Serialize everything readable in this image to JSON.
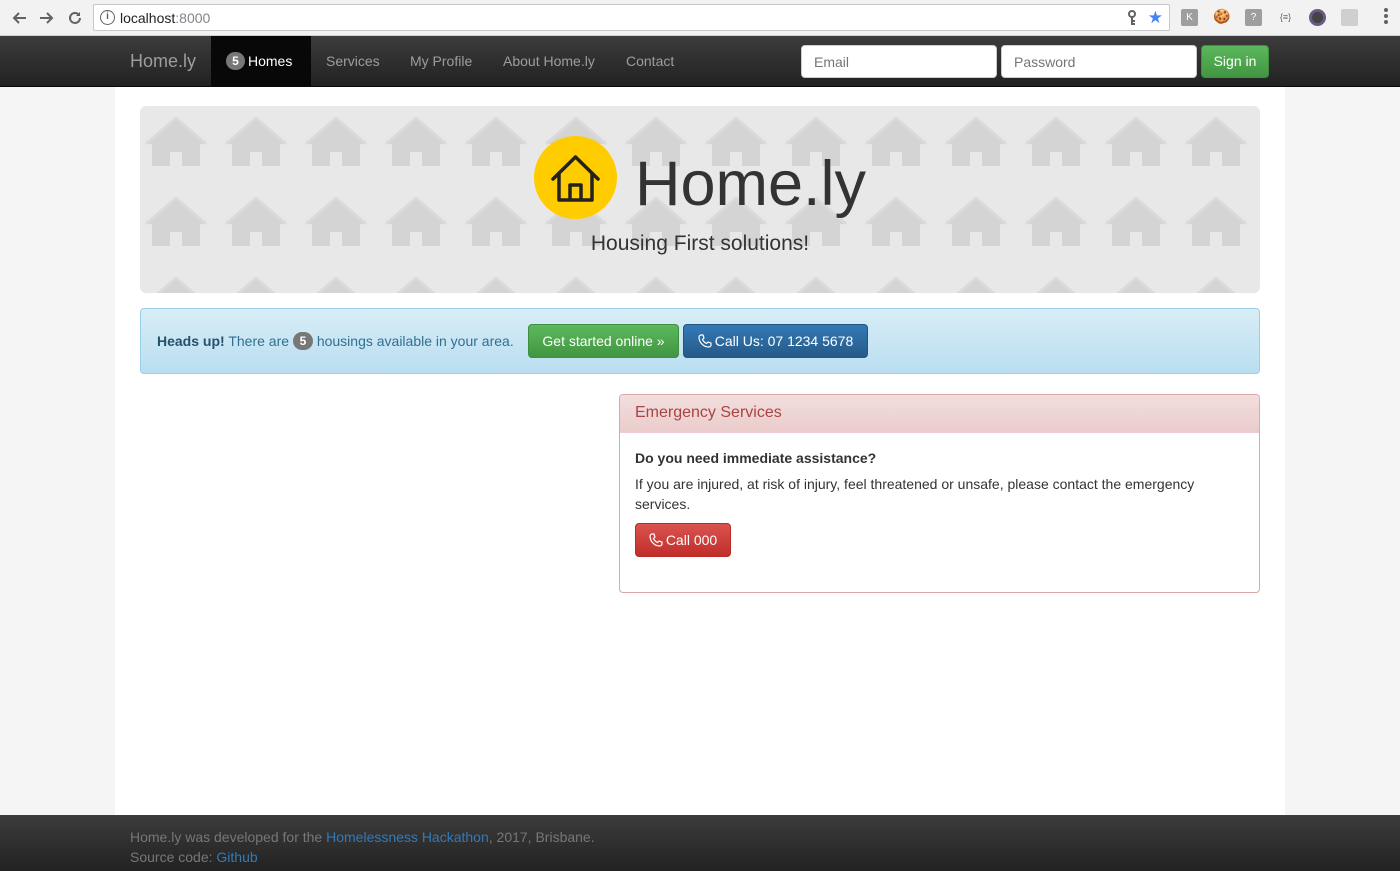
{
  "browser": {
    "url_host": "localhost",
    "url_port": ":8000"
  },
  "navbar": {
    "brand": "Home.ly",
    "homes_count": "5",
    "items": [
      {
        "label": "Homes"
      },
      {
        "label": "Services"
      },
      {
        "label": "My Profile"
      },
      {
        "label": "About Home.ly"
      },
      {
        "label": "Contact"
      }
    ],
    "email_placeholder": "Email",
    "password_placeholder": "Password",
    "signin_label": "Sign in"
  },
  "jumbotron": {
    "title": "Home.ly",
    "subtitle": "Housing First solutions!"
  },
  "alert": {
    "strong": "Heads up!",
    "text_before": "There are",
    "count": "5",
    "text_after": "housings available in your area.",
    "get_started_label": "Get started online »",
    "call_label": "Call Us: 07 1234 5678"
  },
  "emergency": {
    "heading": "Emergency Services",
    "question": "Do you need immediate assistance?",
    "body": "If you are injured, at risk of injury, feel threatened or unsafe, please contact the emergency services.",
    "call_label": "Call 000"
  },
  "footer": {
    "line1_before": "Home.ly was developed for the",
    "hackathon_link": "Homelessness Hackathon",
    "line1_after": ", 2017, Brisbane.",
    "line2_before": "Source code:",
    "github_link": "Github"
  },
  "colors": {
    "navbar_bg": "#222222",
    "logo_yellow": "#ffcc00",
    "success_green": "#5cb85c",
    "primary_blue": "#337ab7",
    "danger_red": "#d9534f",
    "alert_info_bg": "#d9edf7",
    "panel_danger_bg": "#f2dede"
  }
}
